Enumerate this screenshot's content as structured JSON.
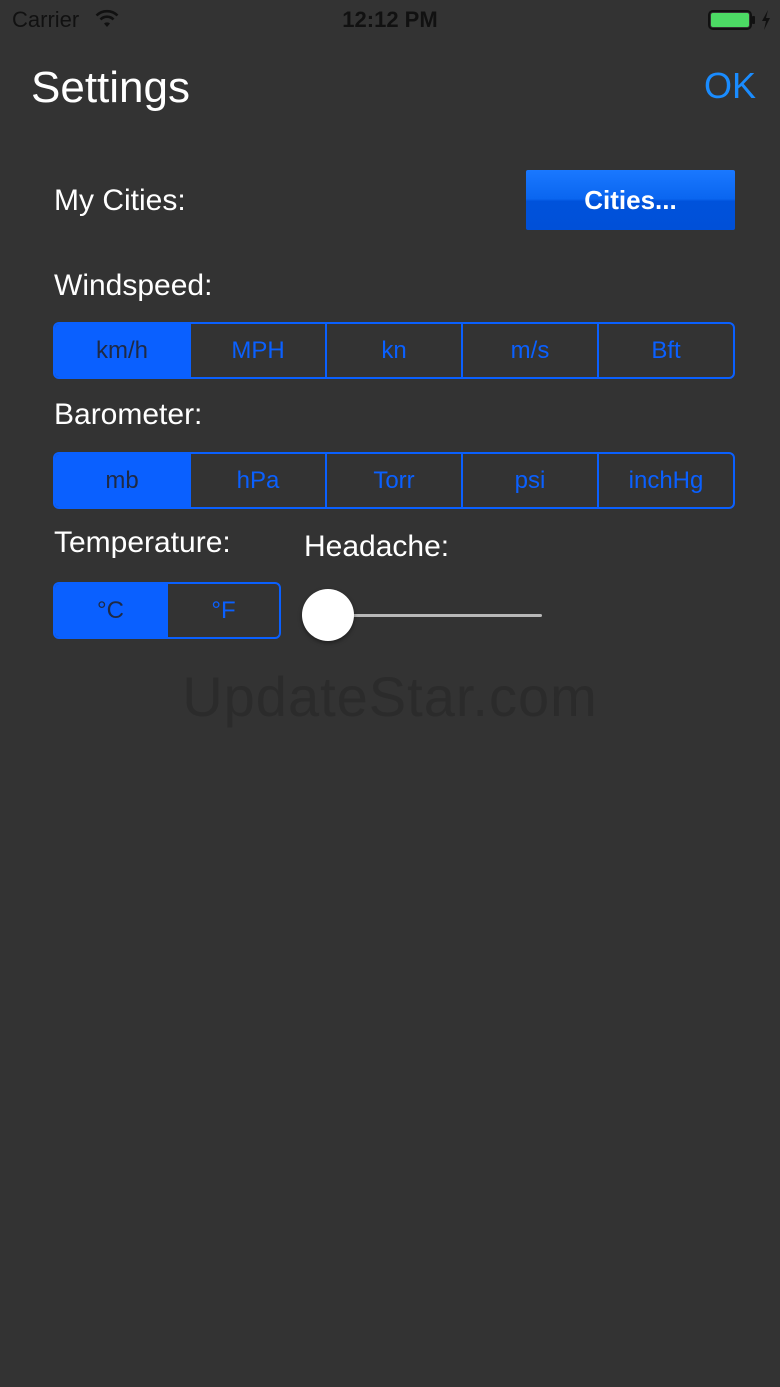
{
  "status_bar": {
    "carrier": "Carrier",
    "time": "12:12 PM",
    "wifi_icon": "wifi-icon",
    "battery_icon": "battery-icon",
    "battery_color": "#4cd964"
  },
  "header": {
    "title": "Settings",
    "ok_label": "OK"
  },
  "cities": {
    "label": "My Cities:",
    "button_label": "Cities..."
  },
  "windspeed": {
    "label": "Windspeed:",
    "options": [
      "km/h",
      "MPH",
      "kn",
      "m/s",
      "Bft"
    ],
    "selected": "km/h"
  },
  "barometer": {
    "label": "Barometer:",
    "options": [
      "mb",
      "hPa",
      "Torr",
      "psi",
      "inchHg"
    ],
    "selected": "mb"
  },
  "temperature": {
    "label": "Temperature:",
    "options": [
      "°C",
      "°F"
    ],
    "selected": "°C"
  },
  "headache": {
    "label": "Headache:",
    "value": 0
  },
  "watermark": "UpdateStar.com",
  "colors": {
    "background": "#333333",
    "accent": "#0a60ff",
    "ok_text": "#1a8cff"
  }
}
